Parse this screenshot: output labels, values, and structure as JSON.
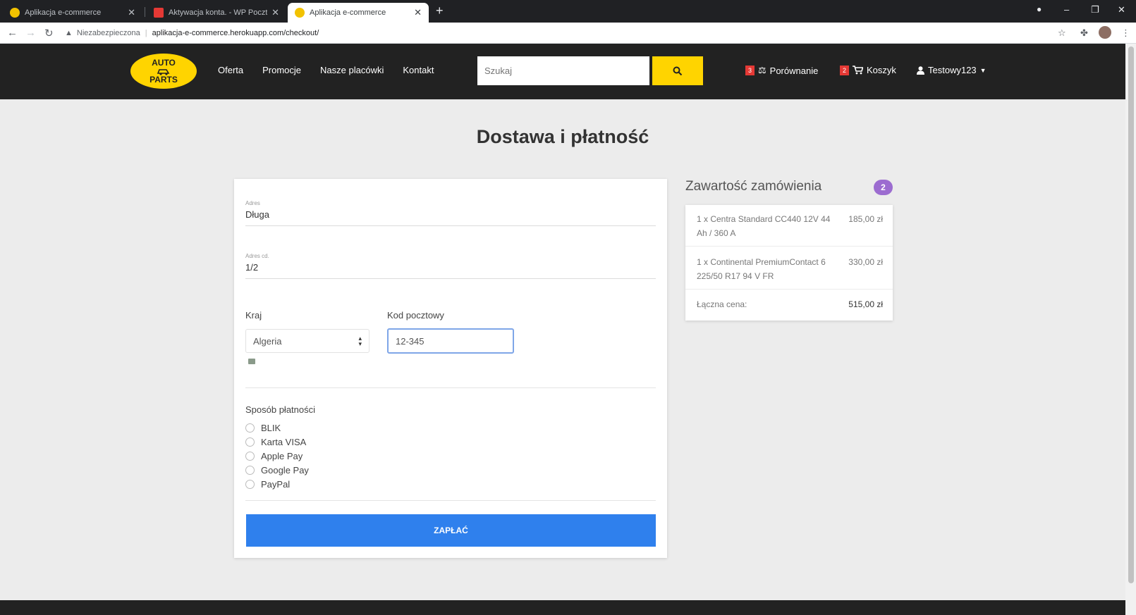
{
  "browser": {
    "tabs": [
      {
        "title": "Aplikacja e-commerce",
        "favicon_color": "#f2c200"
      },
      {
        "title": "Aktywacja konta. - WP Poczta",
        "favicon_color": "#e53935"
      },
      {
        "title": "Aplikacja e-commerce",
        "favicon_color": "#f2c200"
      }
    ],
    "new_tab_icon": "plus-icon",
    "security_label": "Niezabezpieczona",
    "url": "aplikacja-e-commerce.herokuapp.com/checkout/"
  },
  "header": {
    "logo": {
      "line1": "AUTO",
      "line3": "PARTS"
    },
    "nav": [
      "Oferta",
      "Promocje",
      "Nasze placówki",
      "Kontakt"
    ],
    "search_placeholder": "Szukaj",
    "compare": {
      "badge": "3",
      "label": "Porównanie"
    },
    "cart": {
      "badge": "2",
      "label": "Koszyk"
    },
    "user": {
      "label": "Testowy123"
    }
  },
  "page": {
    "title": "Dostawa i płatność"
  },
  "form": {
    "address_label": "Adres",
    "address_value": "Długa",
    "address2_label": "Adres cd.",
    "address2_value": "1/2",
    "country_label": "Kraj",
    "country_value": "Algeria",
    "postal_label": "Kod pocztowy",
    "postal_value": "12-345",
    "payment_label": "Sposób płatności",
    "payment_options": [
      "BLIK",
      "Karta VISA",
      "Apple Pay",
      "Google Pay",
      "PayPal"
    ],
    "pay_button": "ZAPŁAĆ"
  },
  "summary": {
    "title": "Zawartość zamówienia",
    "count": "2",
    "items": [
      {
        "name": "1 x Centra Standard CC440 12V 44 Ah / 360 A",
        "price": "185,00 zł"
      },
      {
        "name": "1 x Continental PremiumContact 6 225/50 R17 94 V FR",
        "price": "330,00 zł"
      }
    ],
    "total_label": "Łączna cena:",
    "total_value": "515,00 zł"
  },
  "colors": {
    "header_bg": "#222222",
    "accent_yellow": "#ffd400",
    "primary_blue": "#2f80ed",
    "badge_red": "#e53935",
    "badge_purple": "#9c6cd0"
  }
}
